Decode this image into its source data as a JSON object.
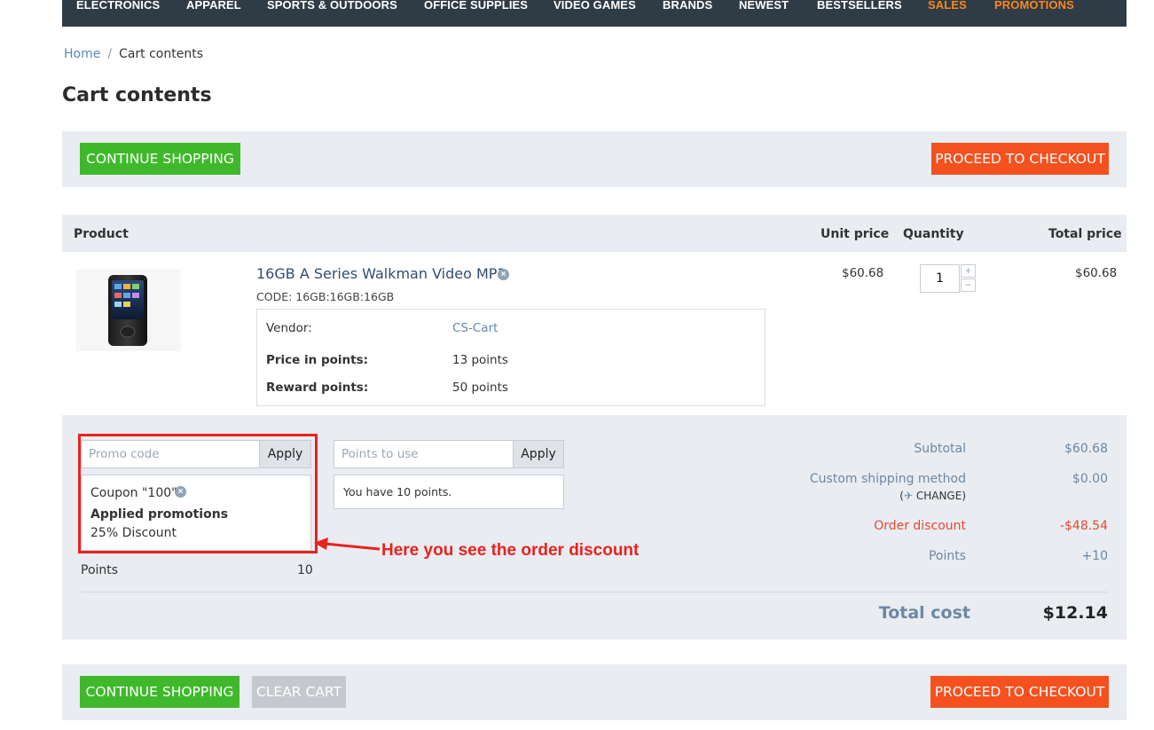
{
  "nav": {
    "items": [
      {
        "label": "ELECTRONICS",
        "accent": false
      },
      {
        "label": "APPAREL",
        "accent": false
      },
      {
        "label": "SPORTS & OUTDOORS",
        "accent": false
      },
      {
        "label": "OFFICE SUPPLIES",
        "accent": false
      },
      {
        "label": "VIDEO GAMES",
        "accent": false
      },
      {
        "label": "BRANDS",
        "accent": false
      },
      {
        "label": "NEWEST",
        "accent": false
      },
      {
        "label": "BESTSELLERS",
        "accent": false
      },
      {
        "label": "SALES",
        "accent": true
      },
      {
        "label": "PROMOTIONS",
        "accent": true
      }
    ],
    "accent_color": "#f6891f",
    "bg_color": "#2f3b45"
  },
  "breadcrumb": {
    "home": "Home",
    "separator": "/",
    "current": "Cart contents"
  },
  "page_title": "Cart contents",
  "top_bar": {
    "continue": "CONTINUE SHOPPING",
    "checkout": "PROCEED TO CHECKOUT"
  },
  "table": {
    "headers": {
      "product": "Product",
      "unit_price": "Unit price",
      "quantity": "Quantity",
      "total_price": "Total price"
    }
  },
  "product": {
    "name": "16GB A Series Walkman Video MP3",
    "code": "CODE: 16GB:16GB:16GB",
    "options": {
      "vendor_label": "Vendor:",
      "vendor_value": "CS-Cart",
      "price_points_label": "Price in points:",
      "price_points_value": "13 points",
      "reward_points_label": "Reward points:",
      "reward_points_value": "50 points"
    },
    "unit_price": "$60.68",
    "quantity": "1",
    "total_price": "$60.68",
    "image_icon": "mp3-player-image"
  },
  "promo": {
    "placeholder": "Promo code",
    "apply": "Apply",
    "coupon": "Coupon \"100\"",
    "applied_title": "Applied promotions",
    "applied_item": "25% Discount"
  },
  "points_box": {
    "placeholder": "Points to use",
    "apply": "Apply",
    "info": "You have 10 points.",
    "label": "Points",
    "value": "10"
  },
  "annotation": {
    "text": "Here you see the order discount",
    "color": "#e8231e"
  },
  "summary": {
    "subtotal_label": "Subtotal",
    "subtotal_value": "$60.68",
    "shipping_label": "Custom shipping method",
    "shipping_value": "$0.00",
    "change_label": "CHANGE",
    "discount_label": "Order discount",
    "discount_value": "-$48.54",
    "points_label": "Points",
    "points_value": "+10",
    "total_label": "Total cost",
    "total_value": "$12.14"
  },
  "bottom_bar": {
    "continue": "CONTINUE SHOPPING",
    "clear": "CLEAR CART",
    "checkout": "PROCEED TO CHECKOUT"
  }
}
